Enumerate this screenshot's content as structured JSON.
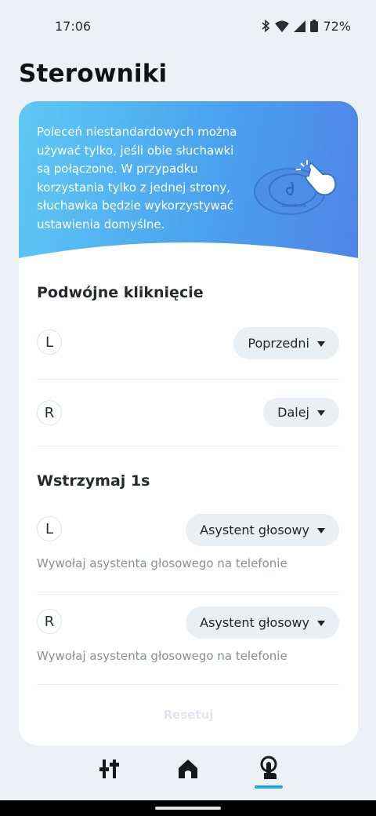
{
  "status_bar": {
    "time": "17:06",
    "battery": "72%",
    "icons": [
      "bluetooth-icon",
      "wifi-icon",
      "signal-icon",
      "battery-icon"
    ]
  },
  "page": {
    "title": "Sterowniki"
  },
  "banner": {
    "text": "Poleceń niestandardowych można używać tylko, jeśli obie słuchawki są połączone. W przypadku korzystania tylko z jednej strony, słuchawka będzie wykorzystywać ustawienia domyślne.",
    "illustration_icon": "earbuds-touch-icon",
    "illustration_brand": "soundcore",
    "gradient": [
      "#5fc9f5",
      "#4f84e8"
    ]
  },
  "double_click": {
    "title": "Podwójne kliknięcie",
    "left": {
      "side": "L",
      "action": "Poprzedni"
    },
    "right": {
      "side": "R",
      "action": "Dalej"
    }
  },
  "hold": {
    "title": "Wstrzymaj  1s",
    "left": {
      "side": "L",
      "action": "Asystent głosowy",
      "description": "Wywołaj asystenta głosowego na telefonie"
    },
    "right": {
      "side": "R",
      "action": "Asystent głosowy",
      "description": "Wywołaj asystenta głosowego na telefonie"
    }
  },
  "reset_label": "Resetuj",
  "bottom_nav": {
    "items": [
      {
        "icon": "equalizer-icon",
        "active": false
      },
      {
        "icon": "home-icon",
        "active": false
      },
      {
        "icon": "touch-control-icon",
        "active": true
      }
    ],
    "accent": "#1da7e9"
  }
}
